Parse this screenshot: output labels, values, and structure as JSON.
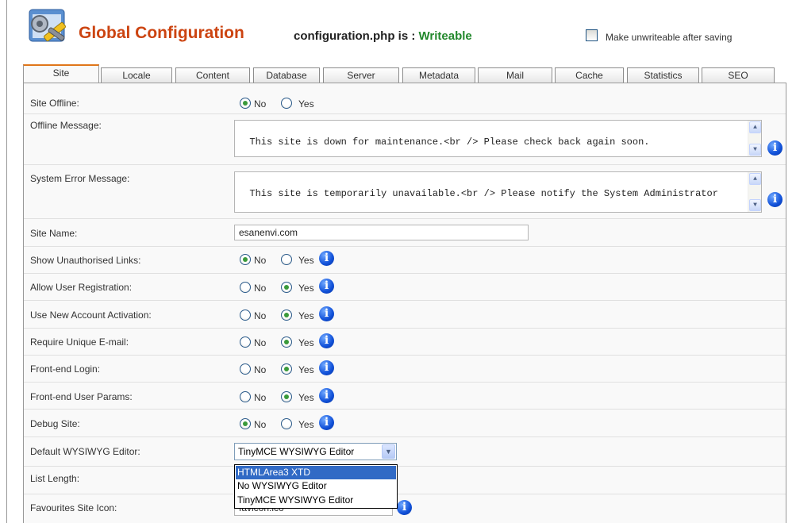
{
  "header": {
    "title": "Global Configuration",
    "file_status_prefix": "configuration.php is : ",
    "file_status_value": "Writeable",
    "unwriteable_label": "Make unwriteable after saving",
    "unwriteable_checked": false
  },
  "tabs": [
    "Site",
    "Locale",
    "Content",
    "Database",
    "Server",
    "Metadata",
    "Mail",
    "Cache",
    "Statistics",
    "SEO"
  ],
  "active_tab": "Site",
  "radio_labels": {
    "no": "No",
    "yes": "Yes"
  },
  "form": {
    "site_offline": {
      "label": "Site Offline:",
      "value": "No"
    },
    "offline_message": {
      "label": "Offline Message:",
      "value": "This site is down for maintenance.<br /> Please check back again soon."
    },
    "system_error_message": {
      "label": "System Error Message:",
      "value": "This site is temporarily unavailable.<br /> Please notify the System Administrator"
    },
    "site_name": {
      "label": "Site Name:",
      "value": "esanenvi.com"
    },
    "show_unauthorised_links": {
      "label": "Show Unauthorised Links:",
      "value": "No"
    },
    "allow_user_registration": {
      "label": "Allow User Registration:",
      "value": "Yes"
    },
    "use_new_account_activation": {
      "label": "Use New Account Activation:",
      "value": "Yes"
    },
    "require_unique_email": {
      "label": "Require Unique E-mail:",
      "value": "Yes"
    },
    "frontend_login": {
      "label": "Front-end Login:",
      "value": "Yes"
    },
    "frontend_user_params": {
      "label": "Front-end User Params:",
      "value": "Yes"
    },
    "debug_site": {
      "label": "Debug Site:",
      "value": "No"
    },
    "default_editor": {
      "label": "Default WYSIWYG Editor:",
      "value": "TinyMCE WYSIWYG Editor",
      "options": [
        "HTMLArea3 XTD",
        "No WYSIWYG Editor",
        "TinyMCE WYSIWYG Editor"
      ],
      "highlighted": "HTMLArea3 XTD"
    },
    "list_length": {
      "label": "List Length:"
    },
    "favourites_site_icon": {
      "label": "Favourites Site Icon:",
      "value": "favicon.ico"
    }
  },
  "icons": {
    "logo": "config-tools-icon",
    "info": "info-icon",
    "select_arrow": "chevron-down-icon"
  },
  "colors": {
    "title": "#cc4411",
    "writeable": "#22882c",
    "active_tab_top": "#e0761a",
    "info_blue": "#1050d8",
    "selected_option": "#316ac5"
  }
}
